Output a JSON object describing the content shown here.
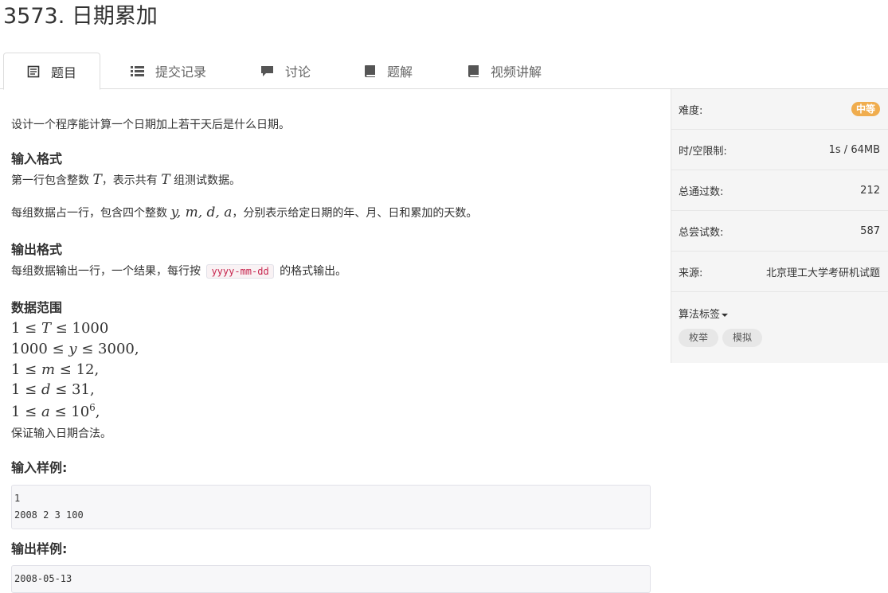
{
  "problem": {
    "title": "3573. 日期累加"
  },
  "tabs": [
    {
      "label": "题目",
      "icon": "document-icon",
      "active": true
    },
    {
      "label": "提交记录",
      "icon": "list-icon"
    },
    {
      "label": "讨论",
      "icon": "comment-icon"
    },
    {
      "label": "题解",
      "icon": "book-icon"
    },
    {
      "label": "视频讲解",
      "icon": "book-icon"
    }
  ],
  "content": {
    "intro": "设计一个程序能计算一个日期加上若干天后是什么日期。",
    "input_heading": "输入格式",
    "input_p1_a": "第一行包含整数 ",
    "var_T": "T",
    "input_p1_b": "，表示共有 ",
    "input_p1_c": " 组测试数据。",
    "input_p2_a": "每组数据占一行，包含四个整数 ",
    "input_p2_vars": "y, m, d, a",
    "input_p2_b": "，分别表示给定日期的年、月、日和累加的天数。",
    "output_heading": "输出格式",
    "output_p_a": "每组数据输出一行，一个结果，每行按 ",
    "output_format_code": "yyyy-mm-dd",
    "output_p_b": " 的格式输出。",
    "range_heading": "数据范围",
    "ranges": [
      {
        "left": "1 ≤ ",
        "var": "T",
        "right": " ≤ 1000",
        "sep": ""
      },
      {
        "left": "1000 ≤ ",
        "var": "y",
        "right": " ≤ 3000",
        "sep": ","
      },
      {
        "left": "1 ≤ ",
        "var": "m",
        "right": " ≤ 12",
        "sep": ","
      },
      {
        "left": "1 ≤ ",
        "var": "d",
        "right": " ≤ 31",
        "sep": ","
      },
      {
        "left": "1 ≤ ",
        "var": "a",
        "right": " ≤ 10",
        "sup": "6",
        "sep": ","
      }
    ],
    "guarantee": "保证输入日期合法。",
    "sample_input_heading": "输入样例:",
    "sample_input": "1\n2008 2 3 100",
    "sample_output_heading": "输出样例:",
    "sample_output": "2008-05-13"
  },
  "sidebar": {
    "difficulty_label": "难度:",
    "difficulty_value": "中等",
    "limit_label": "时/空限制:",
    "limit_value": "1s / 64MB",
    "passed_label": "总通过数:",
    "passed_value": "212",
    "tried_label": "总尝试数:",
    "tried_value": "587",
    "source_label": "来源:",
    "source_value": "北京理工大学考研机试题",
    "tags_label": "算法标签",
    "tags": [
      "枚举",
      "模拟"
    ]
  },
  "colors": {
    "difficulty_badge": "#f0ad4e",
    "code_inline": "#c7254e"
  }
}
